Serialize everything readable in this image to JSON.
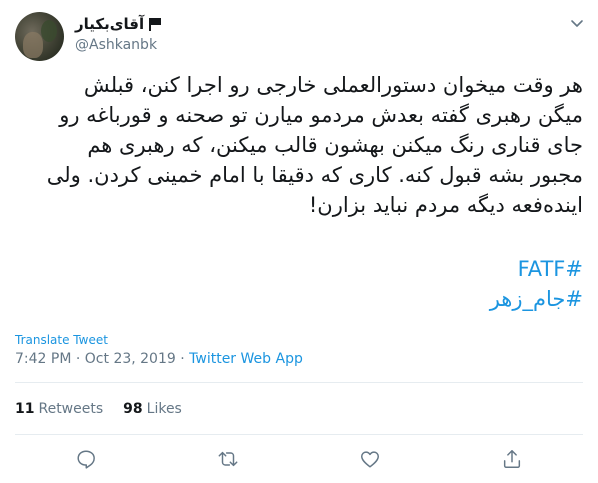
{
  "user": {
    "display_name": "آقای‌بکیار",
    "handle": "@Ashkanbk"
  },
  "tweet": {
    "text": "هر وقت میخوان دستورالعملی خارجی رو اجرا کنن، قبلش\nمیگن رهبری گفته بعدش مردمو میارن تو صحنه و قورباغه رو\nجای قناری رنگ میکنن بهشون قالب میکنن، که رهبری هم\nمجبور بشه قبول کنه. کاری که دقیقا با امام خمینی کردن. ولی\nاینده‌فعه دیگه مردم نباید بزارن!",
    "hashtags": [
      "#FATF",
      "#جام_زهر"
    ]
  },
  "translate_label": "Translate Tweet",
  "meta": {
    "time": "7:42 PM",
    "separator": "·",
    "date": "Oct 23, 2019",
    "source": "Twitter Web App"
  },
  "stats": {
    "retweets_count": "11",
    "retweets_label": "Retweets",
    "likes_count": "98",
    "likes_label": "Likes"
  },
  "icons": {
    "menu": "chevron-down-icon",
    "reply": "reply-icon",
    "retweet": "retweet-icon",
    "like": "heart-icon",
    "share": "share-icon"
  },
  "colors": {
    "link": "#1b95e0",
    "secondary": "#657786",
    "text": "#14171a"
  }
}
